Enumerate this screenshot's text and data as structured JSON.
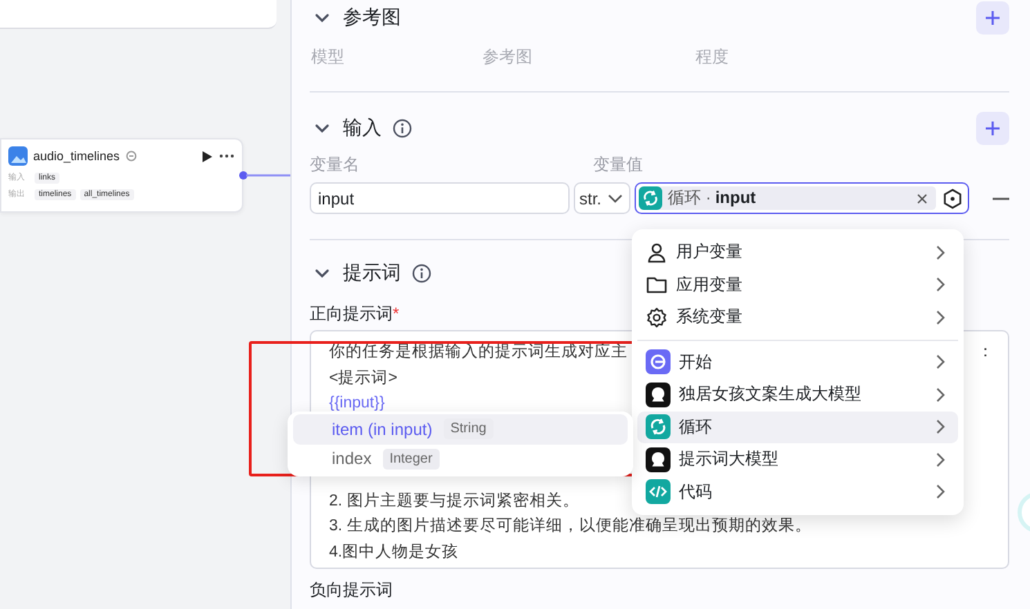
{
  "canvas": {
    "node": {
      "title": "audio_timelines",
      "input_label": "输入",
      "inputs": [
        "links"
      ],
      "output_label": "输出",
      "outputs": [
        "timelines",
        "all_timelines"
      ]
    }
  },
  "panel": {
    "reference_section": {
      "title": "参考图",
      "expanded": true,
      "columns": [
        "模型",
        "参考图",
        "程度"
      ]
    },
    "input_section": {
      "title": "输入",
      "expanded": true,
      "name_label": "变量名",
      "value_label": "变量值",
      "variables": [
        {
          "name": "input",
          "type": "str.",
          "source": "循环",
          "separator": "·",
          "ref": "input"
        }
      ]
    },
    "prompt_section": {
      "title": "提示词",
      "expanded": true,
      "positive_label": "正向提示词",
      "required_mark": "*",
      "positive_blocks": [
        [
          {
            "kind": "text",
            "text": "你的任务是根据输入的提示词生成对应主",
            "tail": "："
          },
          {
            "kind": "text",
            "text": "<提示词>"
          },
          {
            "kind": "variable",
            "text": "{{input}}"
          }
        ],
        [
          {
            "kind": "text",
            "text": "2. 图片主题要与提示词紧密相关。"
          },
          {
            "kind": "text",
            "text": "3. 生成的图片描述要尽可能详细，以便能准确呈现出预期的效果。"
          },
          {
            "kind": "text",
            "text": "4.图中人物是女孩"
          }
        ]
      ],
      "negative_label": "负向提示词"
    }
  },
  "variable_menu": {
    "groups": [
      {
        "kind": "user",
        "label": "用户变量",
        "selected": false
      },
      {
        "kind": "folder",
        "label": "应用变量",
        "selected": false
      },
      {
        "kind": "gear",
        "label": "系统变量",
        "selected": false
      }
    ],
    "nodes": [
      {
        "kind": "start",
        "label": "开始",
        "selected": false
      },
      {
        "kind": "model",
        "label": "独居女孩文案生成大模型",
        "selected": false
      },
      {
        "kind": "loop",
        "label": "循环",
        "selected": true
      },
      {
        "kind": "model",
        "label": "提示词大模型",
        "selected": false
      },
      {
        "kind": "code",
        "label": "代码",
        "selected": false
      }
    ]
  },
  "submenu": {
    "items": [
      {
        "label": "item (in input)",
        "type": "String",
        "selected": true
      },
      {
        "label": "index",
        "type": "Integer",
        "selected": false
      }
    ]
  }
}
